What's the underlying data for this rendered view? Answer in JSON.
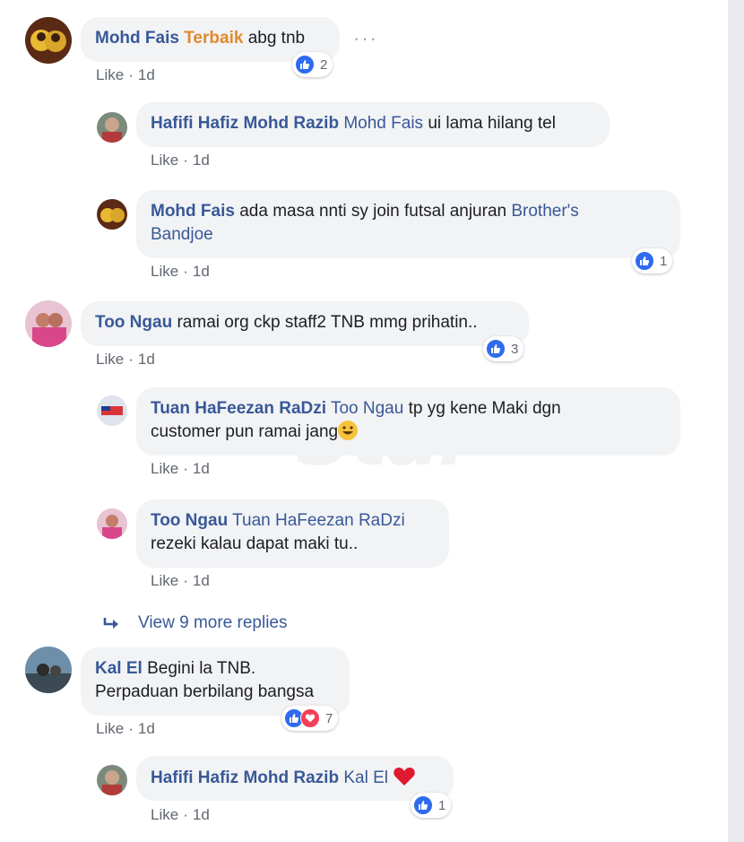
{
  "colors": {
    "name": "#385898",
    "highlight": "#e08a2c",
    "bubble": "#f2f3f5",
    "meta": "#606770",
    "like_reaction": "#2e6bef",
    "love_reaction": "#f33e58"
  },
  "comments": [
    {
      "author": "Mohd Fais",
      "highlight": "Terbaik",
      "text": "abg tnb",
      "like": "Like",
      "time": "1d",
      "reactions": "2",
      "replies": [
        {
          "author": "Hafifi Hafiz Mohd Razib",
          "tag": "Mohd Fais",
          "text": "ui lama hilang tel",
          "like": "Like",
          "time": "1d"
        },
        {
          "author": "Mohd Fais",
          "text": "ada masa nnti sy join futsal anjuran",
          "tag_line1": "Brother's",
          "tag_line2": "Bandjoe",
          "like": "Like",
          "time": "1d",
          "reactions": "1"
        }
      ]
    },
    {
      "author": "Too Ngau",
      "text": "ramai org ckp staff2 TNB mmg prihatin..",
      "like": "Like",
      "time": "1d",
      "reactions": "3",
      "replies": [
        {
          "author": "Tuan HaFeezan RaDzi",
          "tag": "Too Ngau",
          "text_line1": "tp yg kene Maki dgn",
          "text_line2": "customer pun ramai jang",
          "like": "Like",
          "time": "1d"
        },
        {
          "author": "Too Ngau",
          "tag": "Tuan HaFeezan RaDzi",
          "text": "rezeki kalau dapat maki tu..",
          "like": "Like",
          "time": "1d"
        }
      ],
      "view_more": "View 9 more replies"
    },
    {
      "author": "Kal El",
      "text_line1": "Begini la TNB.",
      "text_line2": "Perpaduan berbilang bangsa",
      "like": "Like",
      "time": "1d",
      "reactions": "7",
      "replies": [
        {
          "author": "Hafifi Hafiz Mohd Razib",
          "tag": "Kal El",
          "like": "Like",
          "time": "1d",
          "reactions": "1"
        }
      ]
    }
  ],
  "watermark": "Star",
  "icons": {
    "like": "thumbs-up-icon",
    "love": "heart-icon",
    "more": "more-options-icon",
    "reply_arrow": "reply-arrow-icon",
    "emoji": "grinning-face-icon",
    "heart_emoji": "red-heart-icon"
  }
}
